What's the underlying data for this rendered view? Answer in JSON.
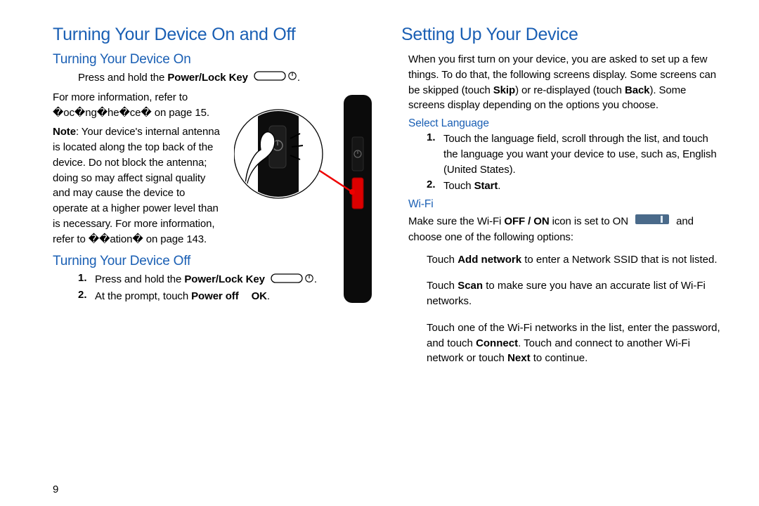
{
  "left": {
    "h1": "Turning Your Device On and Off",
    "h2a": "Turning Your Device On",
    "press_hold_prefix": "Press and hold the ",
    "power_lock": "Power/Lock Key",
    "more_info_intro": "For more information, refer to ",
    "more_info_link": "�oc�ng�he�ce�",
    "more_info_page": " on page 15.",
    "note_label": "Note",
    "note_body": ": Your device's internal antenna is located along the top back of the device. Do not block the antenna; doing so may affect signal quality and may cause the device to operate at a higher power level than is necessary. For more information, refer to ��ation� on page 143.",
    "h2b": "Turning Your Device Off",
    "off_step1": "Press and hold the ",
    "off_step2_pre": "At the prompt, touch ",
    "off_step2_b1": "Power off",
    "off_step2_mid": " ",
    "off_step2_b2": "OK",
    "off_step2_end": ".",
    "page_number": "9"
  },
  "right": {
    "h1": "Setting Up Your Device",
    "intro1": "When you first turn on your device, you are asked to set up a few things. To do that, the following screens display. Some screens can be skipped (touch ",
    "skip": "Skip",
    "intro2": ") or re-displayed (touch ",
    "back": "Back",
    "intro3": "). Some screens display depending on the options you choose.",
    "h3a": "Select Language",
    "lang_step1": "Touch the language field, scroll through the list, and touch the language you want your device to use, such as, English (United States).",
    "lang_step2_pre": "Touch ",
    "lang_step2_b": "Start",
    "lang_step2_end": ".",
    "h3b": "Wi-Fi",
    "wifi_intro1": "Make sure the Wi-Fi ",
    "wifi_offon": "OFF / ON",
    "wifi_intro2": " icon is set to ON ",
    "wifi_intro3": " and choose one of the following options:",
    "wifi_opt1_pre": "Touch ",
    "wifi_opt1_b": "Add network",
    "wifi_opt1_post": " to enter a Network SSID that is not listed.",
    "wifi_opt2_pre": "Touch ",
    "wifi_opt2_b": "Scan",
    "wifi_opt2_post": " to make sure you have an accurate list of Wi-Fi networks.",
    "wifi_opt3_pre": "Touch one of the Wi-Fi networks in the list, enter the password, and touch ",
    "wifi_opt3_b1": "Connect",
    "wifi_opt3_mid": ". Touch and connect to another Wi-Fi network or touch ",
    "wifi_opt3_b2": "Next",
    "wifi_opt3_end": " to continue."
  }
}
